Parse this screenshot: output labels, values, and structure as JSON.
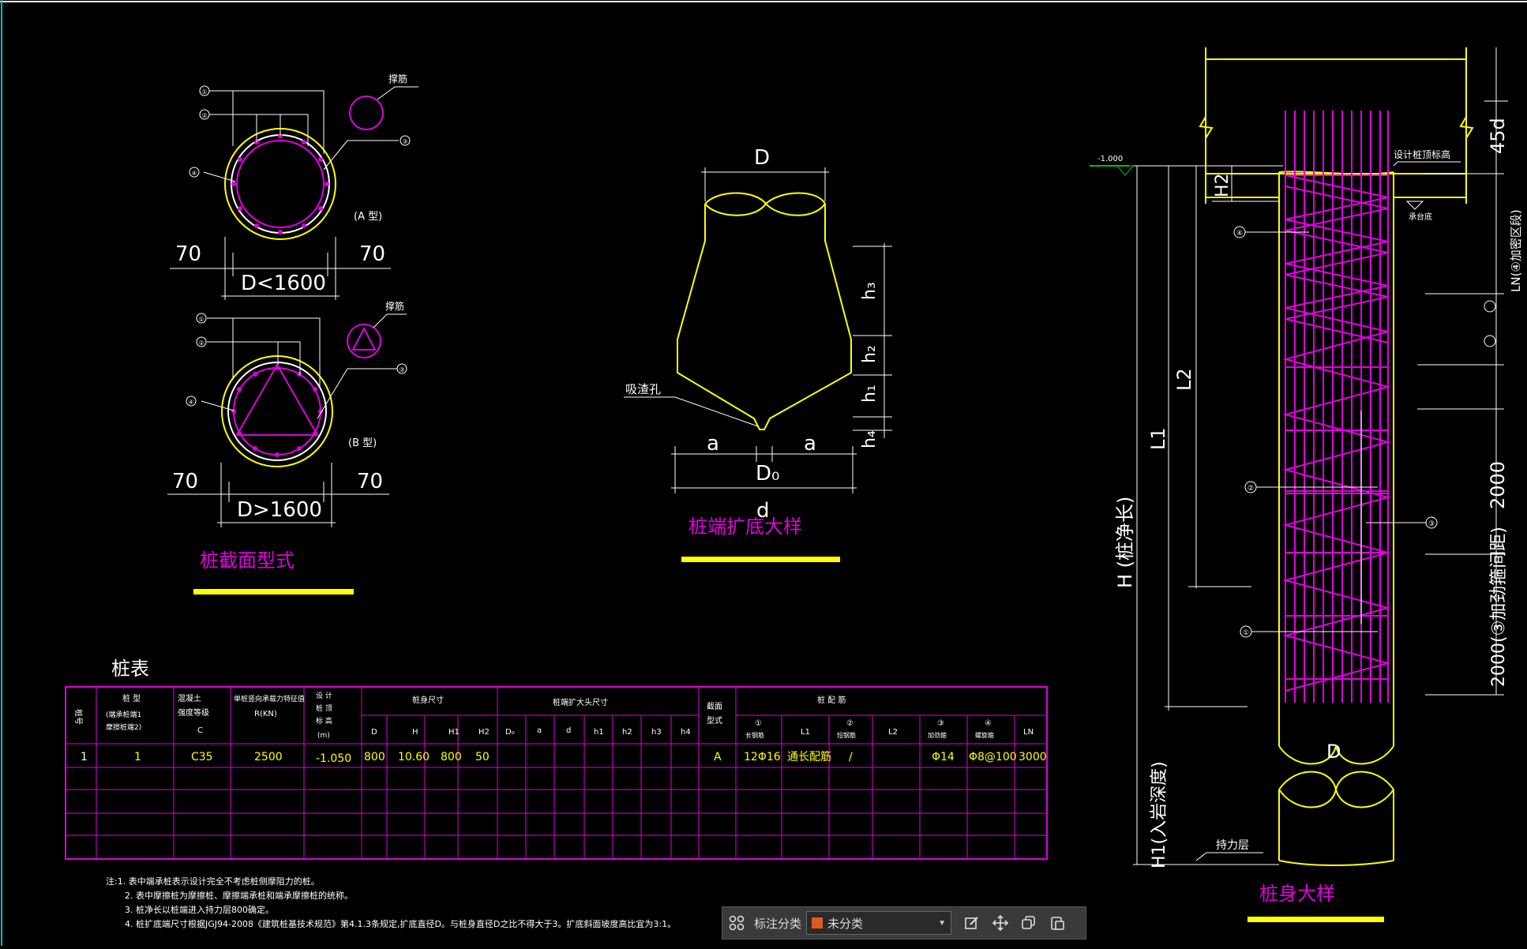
{
  "section_views": {
    "callouts": [
      "①",
      "②",
      "③",
      "④"
    ],
    "type_a": {
      "label": "(A 型)",
      "support_label": "撑筋",
      "offset_left": "70",
      "offset_right": "70",
      "dimension": "D<1600"
    },
    "type_b": {
      "label": "(B 型)",
      "support_label": "撑筋",
      "offset_left": "70",
      "offset_right": "70",
      "dimension": "D>1600"
    },
    "title": "桩截面型式"
  },
  "end_detail": {
    "D": "D",
    "h3": "h₃",
    "h2": "h₂",
    "h1": "h₁",
    "h4": "h₄",
    "hole_label": "吸渣孔",
    "a_left": "a",
    "a_right": "a",
    "D0": "D₀",
    "d": "d",
    "title": "桩端扩底大样"
  },
  "pile_table": {
    "title": "桩表",
    "headers": {
      "no": "桩号",
      "type": "桩 型",
      "type_sub1": "(端承桩端1",
      "type_sub2": "摩擦桩端2)",
      "concrete": "混凝土",
      "concrete_sub": "强度等级",
      "concrete_c": "C",
      "capacity": "单桩竖向承载力特征值",
      "capacity_unit": "R(KN)",
      "elev1": "设 计",
      "elev2": "桩 顶",
      "elev3": "标 高",
      "elev4": "(m)",
      "body_dims": "桩身尺寸",
      "end_dims": "桩端扩大头尺寸",
      "section": "截面",
      "section2": "型式",
      "reinf": "桩 配 筋",
      "D": "D",
      "H": "H",
      "H1": "H1",
      "H2": "H2",
      "D0": "D₀",
      "a": "a",
      "d": "d",
      "h1": "h1",
      "h2": "h2",
      "h3": "h3",
      "h4": "h4",
      "r1": "①",
      "r1_sub": "长钢筋",
      "L1": "L1",
      "r2": "②",
      "r2_sub": "短钢筋",
      "L2": "L2",
      "r3": "③",
      "r3_sub": "加劲箍",
      "r4": "④",
      "r4_sub": "螺旋箍",
      "LN": "LN"
    },
    "rows": [
      {
        "no": "1",
        "type": "1",
        "concrete": "C35",
        "capacity": "2500",
        "elev": "-1.050",
        "D": "800",
        "H": "10.60",
        "H1": "800",
        "H2": "50",
        "D0": "",
        "a": "",
        "d": "",
        "h1": "",
        "h2": "",
        "h3": "",
        "h4": "",
        "section": "A",
        "r1": "12Φ16",
        "L1": "通长配筋",
        "r2": "/",
        "L2": "",
        "r3": "Φ14",
        "r4": "Φ8@100",
        "LN": "3000"
      }
    ],
    "notes": [
      "注:1. 表中端承桩表示设计完全不考虑桩侧摩阻力的桩。",
      "2. 表中摩擦桩为摩擦桩、摩擦端承桩和端承摩擦桩的统称。",
      "3. 桩净长以桩端进入持力层800确定。",
      "4. 桩扩底端尺寸根据JGJ94-2008《建筑桩基技术规范》第4.1.3条规定,扩底直径D。与桩身直径D之比不得大于3。扩底斜面坡度高比宜为3:1。"
    ]
  },
  "body_detail": {
    "ground_level": "-1.000",
    "top_label": "设计桩顶标高",
    "cap_label": "承台底",
    "dim_45d": "45d",
    "H2": "H2",
    "L2": "L2",
    "L1": "L1",
    "H": "H (桩净长)",
    "H1": "H1(入岩深度)",
    "LN": "LN(④加密区段)",
    "dim_2000_a": "2000",
    "dim_2000_b": "2000(③加劲箍间距)",
    "bearing_label": "持力层",
    "D": "D",
    "title": "桩身大样",
    "callouts": [
      "④",
      "②",
      "①",
      "③"
    ]
  },
  "toolbar": {
    "grid_icon": "grid-icon",
    "label": "标注分类",
    "select_value": "未分类",
    "swatch_color": "#e05a1e",
    "buttons": [
      "edit-icon",
      "move-icon",
      "copy-icon",
      "paste-icon"
    ]
  },
  "colors": {
    "background": "#000000",
    "line": "#ffffff",
    "magenta": "#e000e0",
    "yellow": "#ffff00",
    "green": "#00c000"
  }
}
